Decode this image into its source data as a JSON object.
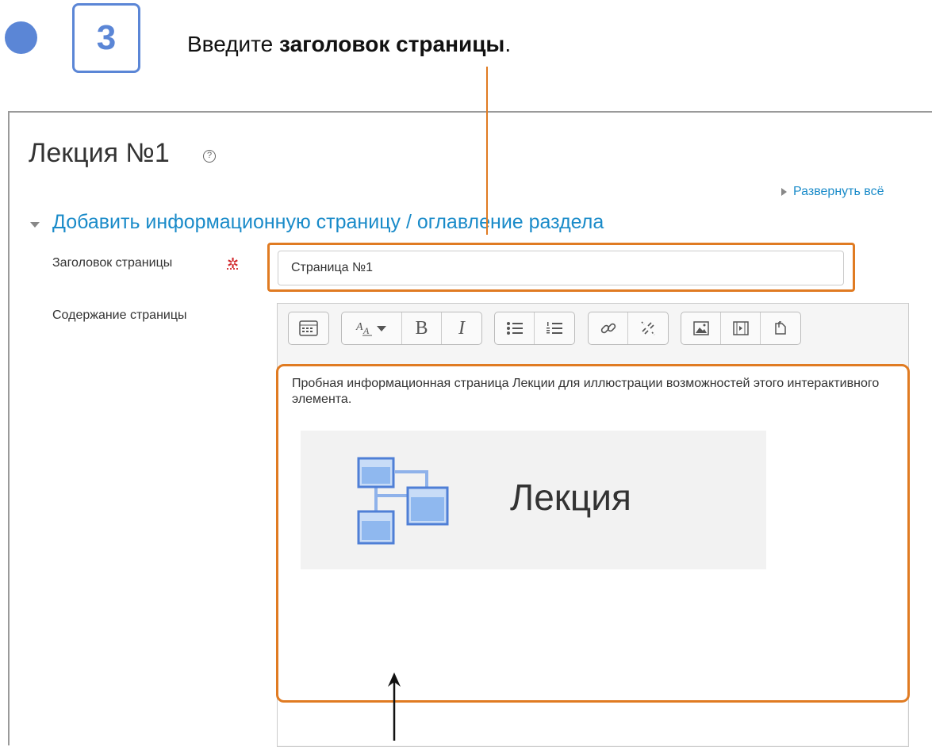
{
  "step": {
    "number": "3",
    "text_prefix": "Введите ",
    "text_bold": "заголовок страницы",
    "text_suffix": "."
  },
  "page": {
    "title": "Лекция №1",
    "help_icon": "question-circle-icon",
    "expand_all_label": "Развернуть всё",
    "section_title": "Добавить информационную страницу / оглавление раздела"
  },
  "form": {
    "title_label": "Заголовок страницы",
    "required_mark": "✲",
    "title_value": "Страница №1",
    "content_label": "Содержание страницы"
  },
  "editor": {
    "toolbar_icons": [
      "show-more-buttons-icon",
      "font-size-icon",
      "bold-icon",
      "italic-icon",
      "unordered-list-icon",
      "ordered-list-icon",
      "link-icon",
      "unlink-icon",
      "image-icon",
      "media-icon",
      "file-icon"
    ],
    "bold_glyph": "B",
    "italic_glyph": "I",
    "content_text": "Пробная информационная страница Лекции для иллюстрации возможностей этого интерактивного элемента.",
    "banner_caption": "Лекция"
  },
  "colors": {
    "accent_blue": "#5b86d6",
    "link_blue": "#1a8bc9",
    "highlight_orange": "#e07b22",
    "required_red": "#d2272b"
  }
}
